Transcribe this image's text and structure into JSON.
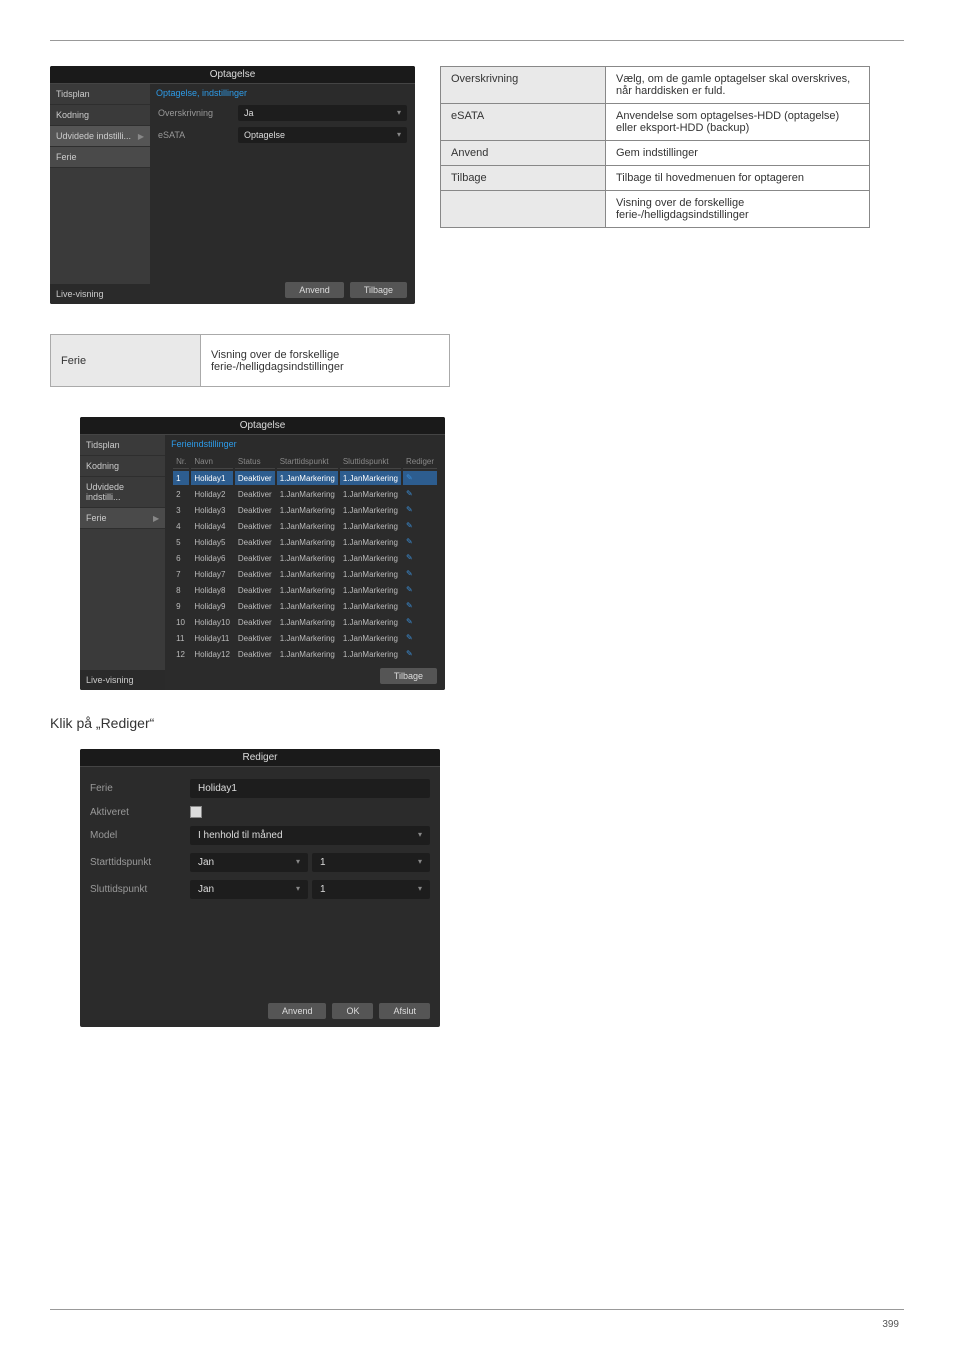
{
  "footer_page": "399",
  "screenshot1": {
    "title": "Optagelse",
    "sidebar": {
      "items": [
        "Tidsplan",
        "Kodning",
        "Udvidede indstilli...",
        "Ferie"
      ],
      "selected_index": 2,
      "footer": "Live-visning"
    },
    "tab": "Optagelse, indstillinger",
    "rows": [
      {
        "label": "Overskrivning",
        "value": "Ja"
      },
      {
        "label": "eSATA",
        "value": "Optagelse"
      }
    ],
    "buttons": {
      "apply": "Anvend",
      "back": "Tilbage"
    }
  },
  "table1": {
    "rows": [
      {
        "label": "Overskrivning",
        "value": "Vælg, om de gamle optagelser skal overskrives, når harddisken er fuld."
      },
      {
        "label": "eSATA",
        "value": "Anvendelse som optagelses-HDD (optagelse) eller eksport-HDD (backup)"
      },
      {
        "label": "Anvend",
        "value": "Gem indstillinger"
      },
      {
        "label": "Tilbage",
        "value": "Tilbage til hovedmenuen for optageren"
      },
      {
        "label": "",
        "value": "Visning over de forskellige ferie-/helligdagsindstillinger"
      }
    ]
  },
  "single_table": {
    "label": "Ferie",
    "value": "Visning over de forskellige ferie-/helligdagsindstillinger"
  },
  "screenshot2": {
    "title": "Optagelse",
    "sidebar": {
      "items": [
        "Tidsplan",
        "Kodning",
        "Udvidede indstilli...",
        "Ferie"
      ],
      "selected_index": 3,
      "footer": "Live-visning"
    },
    "tab": "Ferieindstillinger",
    "columns": [
      "Nr.",
      "Navn",
      "Status",
      "Starttidspunkt",
      "Sluttidspunkt",
      "Rediger"
    ],
    "rows": [
      {
        "nr": "1",
        "name": "Holiday1",
        "status": "Deaktiver",
        "start": "1.JanMarkering",
        "end": "1.JanMarkering"
      },
      {
        "nr": "2",
        "name": "Holiday2",
        "status": "Deaktiver",
        "start": "1.JanMarkering",
        "end": "1.JanMarkering"
      },
      {
        "nr": "3",
        "name": "Holiday3",
        "status": "Deaktiver",
        "start": "1.JanMarkering",
        "end": "1.JanMarkering"
      },
      {
        "nr": "4",
        "name": "Holiday4",
        "status": "Deaktiver",
        "start": "1.JanMarkering",
        "end": "1.JanMarkering"
      },
      {
        "nr": "5",
        "name": "Holiday5",
        "status": "Deaktiver",
        "start": "1.JanMarkering",
        "end": "1.JanMarkering"
      },
      {
        "nr": "6",
        "name": "Holiday6",
        "status": "Deaktiver",
        "start": "1.JanMarkering",
        "end": "1.JanMarkering"
      },
      {
        "nr": "7",
        "name": "Holiday7",
        "status": "Deaktiver",
        "start": "1.JanMarkering",
        "end": "1.JanMarkering"
      },
      {
        "nr": "8",
        "name": "Holiday8",
        "status": "Deaktiver",
        "start": "1.JanMarkering",
        "end": "1.JanMarkering"
      },
      {
        "nr": "9",
        "name": "Holiday9",
        "status": "Deaktiver",
        "start": "1.JanMarkering",
        "end": "1.JanMarkering"
      },
      {
        "nr": "10",
        "name": "Holiday10",
        "status": "Deaktiver",
        "start": "1.JanMarkering",
        "end": "1.JanMarkering"
      },
      {
        "nr": "11",
        "name": "Holiday11",
        "status": "Deaktiver",
        "start": "1.JanMarkering",
        "end": "1.JanMarkering"
      },
      {
        "nr": "12",
        "name": "Holiday12",
        "status": "Deaktiver",
        "start": "1.JanMarkering",
        "end": "1.JanMarkering"
      }
    ],
    "buttons": {
      "back": "Tilbage"
    }
  },
  "instruction": "Klik på „Rediger“",
  "rediger": {
    "title": "Rediger",
    "rows": {
      "ferie_label": "Ferie",
      "ferie_value": "Holiday1",
      "akt_label": "Aktiveret",
      "model_label": "Model",
      "model_value": "I henhold til måned",
      "start_label": "Starttidspunkt",
      "start_month": "Jan",
      "start_day": "1",
      "end_label": "Sluttidspunkt",
      "end_month": "Jan",
      "end_day": "1"
    },
    "buttons": {
      "apply": "Anvend",
      "ok": "OK",
      "afslut": "Afslut"
    }
  }
}
